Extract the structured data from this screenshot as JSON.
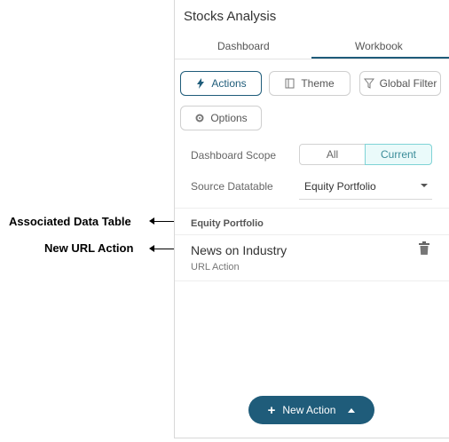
{
  "annotations": {
    "associated_data_table": "Associated Data Table",
    "new_url_action": "New URL Action"
  },
  "panel": {
    "title": "Stocks Analysis",
    "tabs": [
      "Dashboard",
      "Workbook"
    ],
    "active_tab": "Workbook",
    "buttons": {
      "actions": "Actions",
      "theme": "Theme",
      "global_filter": "Global Filter",
      "options": "Options"
    },
    "dashboard_scope": {
      "label": "Dashboard Scope",
      "options": [
        "All",
        "Current"
      ],
      "selected": "Current"
    },
    "source_datatable": {
      "label": "Source Datatable",
      "value": "Equity Portfolio"
    },
    "section_title": "Equity Portfolio",
    "action_item": {
      "name": "News on Industry",
      "type": "URL Action"
    },
    "new_action_button": "New Action"
  },
  "colors": {
    "accent": "#1f5c7a",
    "scope_selected_border": "#7fd3d6",
    "scope_selected_bg": "#eafafa"
  },
  "icons": {
    "actions": "lightning-icon",
    "theme": "theme-book-icon",
    "global_filter": "filter-funnel-icon",
    "options": "gear-icon",
    "delete": "trash-icon",
    "new_action": "plus-icon",
    "menu": "chevron-up-icon"
  }
}
